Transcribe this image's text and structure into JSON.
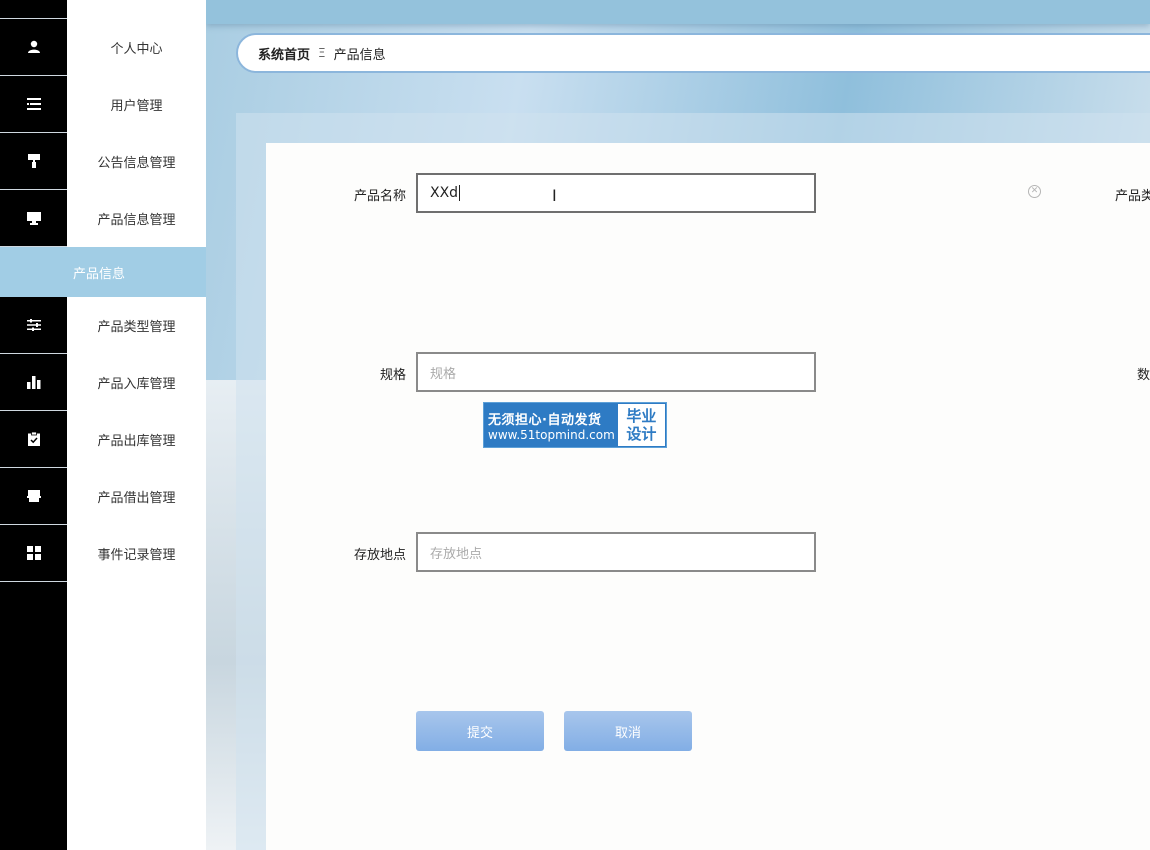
{
  "sidebar": {
    "items": [
      {
        "label": "个人中心",
        "icon": "person-icon"
      },
      {
        "label": "用户管理",
        "icon": "list-icon"
      },
      {
        "label": "公告信息管理",
        "icon": "paint-roller-icon"
      },
      {
        "label": "产品信息管理",
        "icon": "monitor-icon"
      },
      {
        "label": "产品类型管理",
        "icon": "sliders-icon"
      },
      {
        "label": "产品入库管理",
        "icon": "bar-chart-icon"
      },
      {
        "label": "产品出库管理",
        "icon": "clipboard-check-icon"
      },
      {
        "label": "产品借出管理",
        "icon": "printer-icon"
      },
      {
        "label": "事件记录管理",
        "icon": "grid-icon"
      }
    ],
    "active_sub": "产品信息"
  },
  "breadcrumb": {
    "home": "系统首页",
    "separator": "Ξ",
    "current": "产品信息"
  },
  "form": {
    "name_label": "产品名称",
    "name_value": "XXd",
    "type_label": "产品类",
    "spec_label": "规格",
    "spec_placeholder": "规格",
    "qty_label": "数",
    "location_label": "存放地点",
    "location_placeholder": "存放地点",
    "submit_label": "提交",
    "cancel_label": "取消"
  },
  "watermark": {
    "line1": "无须担心·自动发货",
    "line2": "www.51topmind.com",
    "right1": "毕业",
    "right2": "设计"
  },
  "colors": {
    "sidebar_active": "#a1cde5",
    "button": "#8fb5e8",
    "rail": "#000000"
  }
}
